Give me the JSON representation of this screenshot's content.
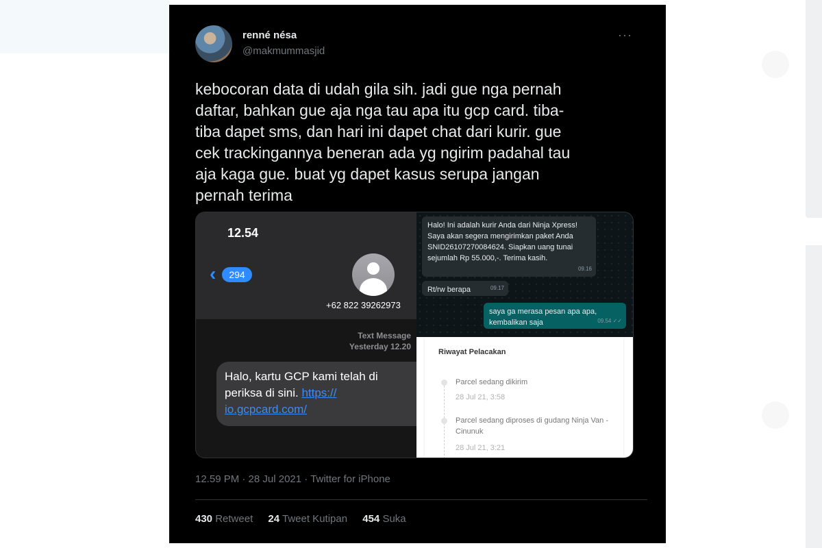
{
  "tweet": {
    "display_name": "renné nésa",
    "handle": "@makmummasjid",
    "more_icon": "more-horizontal-icon",
    "text": "kebocoran data di udah gila sih. jadi gue nga pernah\ndaftar, bahkan gue aja nga tau apa itu gcp card. tiba-\ntiba dapet sms, dan hari ini dapet chat dari kurir. gue\ncek trackingannya beneran ada yg ngirim padahal tau\naja kaga gue. buat yg dapet kasus serupa jangan\npernah terima",
    "meta": "12.59 PM · 28 Jul 2021 · Twitter for iPhone",
    "stats": {
      "retweets_count": "430",
      "retweets_label": "Retweet",
      "quotes_count": "24",
      "quotes_label": "Tweet Kutipan",
      "likes_count": "454",
      "likes_label": "Suka"
    }
  },
  "sms_screenshot": {
    "status_time": "12.54",
    "back_badge": "294",
    "contact_number": "+62 822 39262973",
    "label_type": "Text Message",
    "label_time": "Yesterday 12.20",
    "message_text": "Halo, kartu GCP kami telah di",
    "message_line2": "periksa di sini. ",
    "message_link": "https://",
    "message_link2": "io.gcpcard.com/"
  },
  "wa_screenshot": {
    "msg1": "Halo! Ini adalah kurir Anda dari Ninja Xpress! Saya akan segera mengirimkan paket Anda SNID26107270084624. Siapkan uang tunai sejumlah Rp 55.000,-. Terima kasih.",
    "msg1_time": "09.16",
    "msg2": "Rt/rw berapa",
    "msg2_time": "09.17",
    "msg3": "saya ga merasa pesan apa apa, kembalikan saja",
    "msg3_time": "09.54 ✓✓"
  },
  "tracking": {
    "title": "Riwayat Pelacakan",
    "events": [
      {
        "text": "Parcel sedang dikirim",
        "date": "28 Jul 21, 3:58"
      },
      {
        "text": "Parcel sedang diproses di gudang Ninja Van - Cinunuk",
        "date": "28 Jul 21, 3:21"
      }
    ]
  }
}
